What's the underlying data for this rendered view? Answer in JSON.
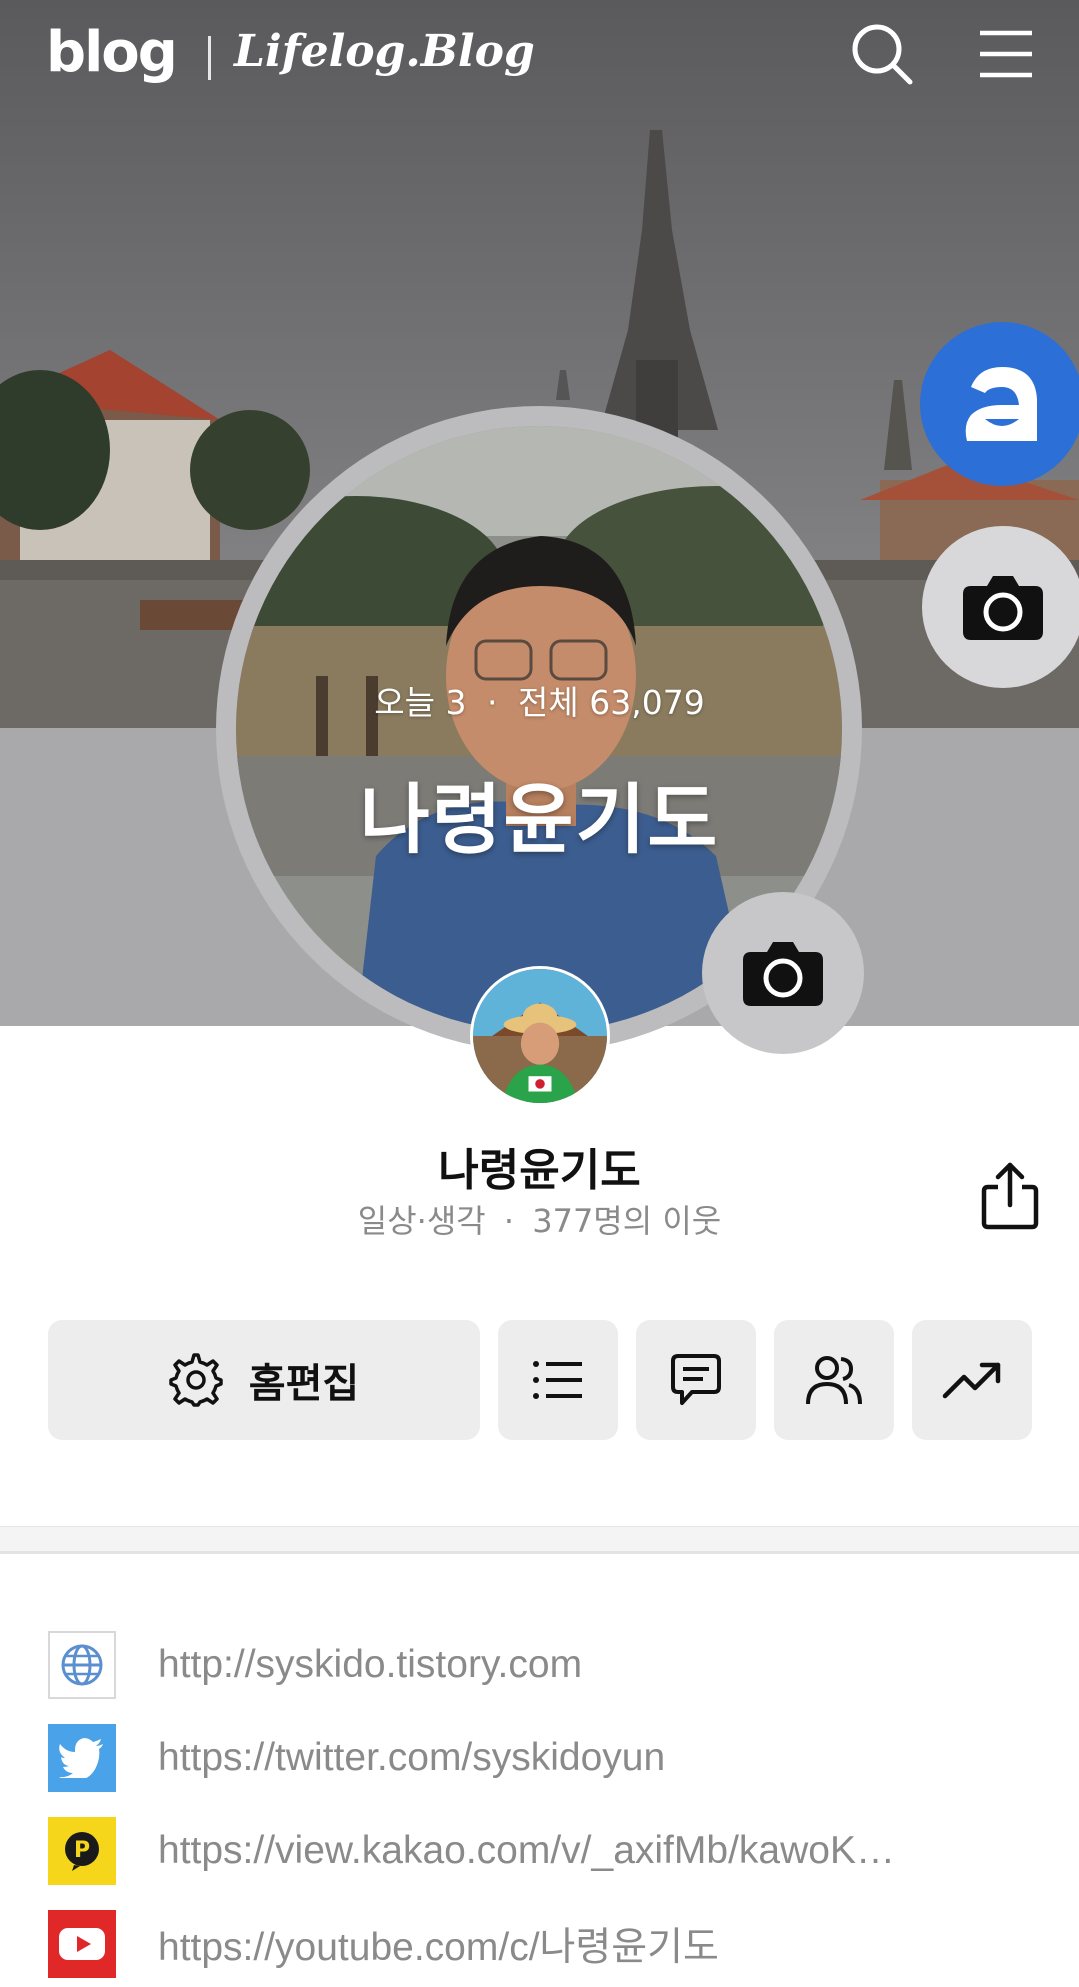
{
  "header": {
    "logo": "blog",
    "blog_name": "Lifelog.Blog"
  },
  "cover": {
    "today_label": "오늘",
    "today_count": "3",
    "total_label": "전체",
    "total_count": "63,079",
    "title": "나령윤기도"
  },
  "profile": {
    "name": "나령윤기도",
    "category": "일상·생각",
    "neighbors": "377명의 이웃"
  },
  "actions": {
    "edit_label": "홈편집"
  },
  "links": [
    {
      "icon": "globe-icon",
      "text": "http://syskido.tistory.com"
    },
    {
      "icon": "twitter-icon",
      "text": "https://twitter.com/syskidoyun"
    },
    {
      "icon": "kakao-page-icon",
      "text": "https://view.kakao.com/v/_axifMb/kawoK…"
    },
    {
      "icon": "youtube-icon",
      "text": "https://youtube.com/c/나령윤기도"
    }
  ],
  "colors": {
    "fab_blue": "#2c6fd6",
    "twitter": "#4aa3e8",
    "kakao": "#f6d61a",
    "youtube": "#e02828"
  }
}
